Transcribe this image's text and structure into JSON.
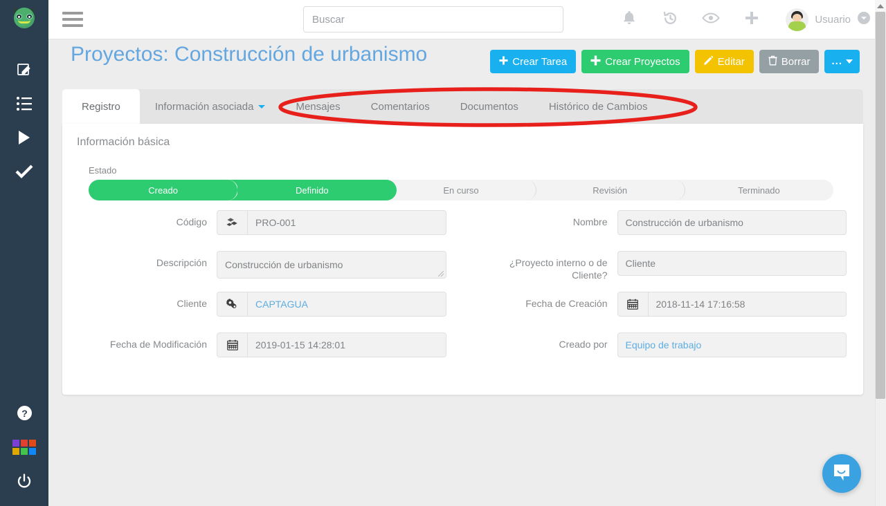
{
  "sidebar": {
    "logo": "monster-logo",
    "items": [
      {
        "name": "edit-icon",
        "icon": "pencil-square"
      },
      {
        "name": "list-icon",
        "icon": "bullet-list"
      },
      {
        "name": "play-icon",
        "icon": "play-triangle"
      },
      {
        "name": "check-icon",
        "icon": "checkmark"
      }
    ],
    "bottom": [
      {
        "name": "help-icon",
        "icon": "question-circle"
      },
      {
        "name": "apps-grid-icon",
        "icon": "color-grid",
        "colors": [
          "#7b3fd4",
          "#e0402f",
          "#e04a1b",
          "#dfa800",
          "#41c34c",
          "#1187f5"
        ]
      },
      {
        "name": "power-icon",
        "icon": "power"
      }
    ]
  },
  "topbar": {
    "menu_toggle": "hamburger-menu",
    "search": {
      "value": "",
      "placeholder": "Buscar"
    },
    "icons": [
      "bell-icon",
      "history-icon",
      "eye-icon",
      "plus-icon"
    ],
    "user_name": "Usuario"
  },
  "header": {
    "title": "Proyectos: Construcción de urbanismo",
    "buttons": [
      {
        "label": "Crear Tarea",
        "style": "blue",
        "icon": "plus-icon"
      },
      {
        "label": "Crear Proyectos",
        "style": "green",
        "icon": "plus-icon"
      },
      {
        "label": "Editar",
        "style": "yellow",
        "icon": "pencil-icon"
      },
      {
        "label": "Borrar",
        "style": "grey",
        "icon": "trash-icon"
      },
      {
        "label": "...",
        "style": "more",
        "icon": "caret-down-icon"
      }
    ]
  },
  "tabs": [
    {
      "label": "Registro",
      "active": true,
      "dropdown": false
    },
    {
      "label": "Información asociada",
      "active": false,
      "dropdown": true
    },
    {
      "label": "Mensajes",
      "active": false,
      "dropdown": false
    },
    {
      "label": "Comentarios",
      "active": false,
      "dropdown": false
    },
    {
      "label": "Documentos",
      "active": false,
      "dropdown": false
    },
    {
      "label": "Histórico de Cambios",
      "active": false,
      "dropdown": false
    }
  ],
  "annotation": {
    "shape": "ellipse-highlight",
    "color": "#e8201c",
    "covers_tabs": [
      "Mensajes",
      "Comentarios",
      "Documentos",
      "Histórico de Cambios"
    ]
  },
  "content": {
    "section_title": "Información básica",
    "status": {
      "label": "Estado",
      "steps": [
        "Creado",
        "Definido",
        "En curso",
        "Revisión",
        "Terminado"
      ],
      "completed_count": 2,
      "done_color": "#2ecc71",
      "pending_color": "#f3f3f3"
    },
    "fields_left": [
      {
        "label": "Código",
        "value": "PRO-001",
        "addon": "cubes-icon",
        "link": false
      },
      {
        "label": "Descripción",
        "value": "Construcción de urbanismo",
        "addon": null,
        "link": false,
        "textarea": true
      },
      {
        "label": "Cliente",
        "value": "CAPTAGUA",
        "addon": "gears-icon",
        "link": true
      },
      {
        "label": "Fecha de Modificación",
        "value": "2019-01-15 14:28:01",
        "addon": "calendar-icon",
        "link": false
      }
    ],
    "fields_right": [
      {
        "label": "Nombre",
        "value": "Construcción de urbanismo",
        "addon": null,
        "link": false
      },
      {
        "label": "¿Proyecto interno o de Cliente?",
        "value": "Cliente",
        "addon": null,
        "link": false
      },
      {
        "label": "Fecha de Creación",
        "value": "2018-11-14 17:16:58",
        "addon": "calendar-icon",
        "link": false
      },
      {
        "label": "Creado por",
        "value": "Equipo de trabajo",
        "addon": null,
        "link": true
      }
    ]
  },
  "chat": {
    "name": "intercom-chat-button",
    "icon": "chat-bubble-smile"
  },
  "scrollbar": {
    "name": "page-scrollbar",
    "position": "right"
  }
}
